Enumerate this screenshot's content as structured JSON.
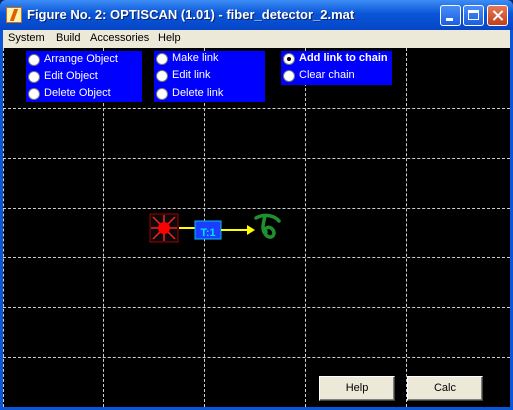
{
  "window": {
    "title": "Figure No. 2: OPTISCAN (1.01) - fiber_detector_2.mat"
  },
  "menu": [
    "System",
    "Build",
    "Accessories",
    "Help"
  ],
  "panels": {
    "object": [
      "Arrange Object",
      "Edit Object",
      "Delete Object"
    ],
    "link": [
      "Make link",
      "Edit link",
      "Delete link"
    ],
    "chain": [
      "Add link to chain",
      "Clear chain"
    ]
  },
  "chain_selected": "Add link to chain",
  "canvas": {
    "node_label": "T:1",
    "colors": {
      "background": "#000000",
      "panel": "#0000ff",
      "link": "#ffff00",
      "source": "#ff0000",
      "detector": "#1f8f2f"
    }
  },
  "buttons": {
    "help": "Help",
    "calc": "Calc"
  }
}
